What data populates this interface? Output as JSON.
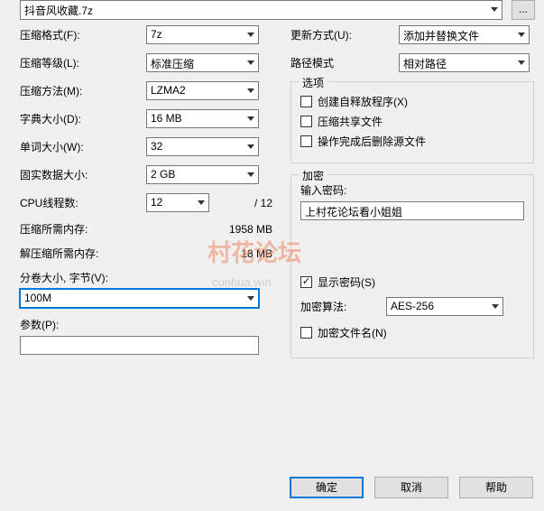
{
  "archive_name": "抖音风收藏.7z",
  "browse": "...",
  "left": {
    "format_label": "压缩格式(F):",
    "format": "7z",
    "level_label": "压缩等级(L):",
    "level": "标准压缩",
    "method_label": "压缩方法(M):",
    "method": "LZMA2",
    "dict_label": "字典大小(D):",
    "dict": "16 MB",
    "word_label": "单词大小(W):",
    "word": "32",
    "solid_label": "固实数据大小:",
    "solid": "2 GB",
    "cpu_label": "CPU线程数:",
    "cpu": "12",
    "cpu_max": "/ 12",
    "mem_comp_label": "压缩所需内存:",
    "mem_comp": "1958 MB",
    "mem_decomp_label": "解压缩所需内存:",
    "mem_decomp": "18 MB",
    "split_label": "分卷大小, 字节(V):",
    "split": "100M",
    "params_label": "参数(P):",
    "params": ""
  },
  "right": {
    "update_label": "更新方式(U):",
    "update": "添加并替换文件",
    "path_label": "路径模式",
    "path": "相对路径",
    "options_legend": "选项",
    "opt_sfx": "创建自释放程序(X)",
    "opt_shared": "压缩共享文件",
    "opt_delete": "操作完成后删除源文件",
    "encrypt_legend": "加密",
    "pwd_label": "输入密码:",
    "pwd_value": "上村花论坛看小姐姐",
    "show_pwd": "显示密码(S)",
    "algo_label": "加密算法:",
    "algo": "AES-256",
    "encrypt_names": "加密文件名(N)"
  },
  "buttons": {
    "ok": "确定",
    "cancel": "取消",
    "help": "帮助"
  },
  "watermark": {
    "text": "村花论坛",
    "url": "cunhua.win"
  }
}
